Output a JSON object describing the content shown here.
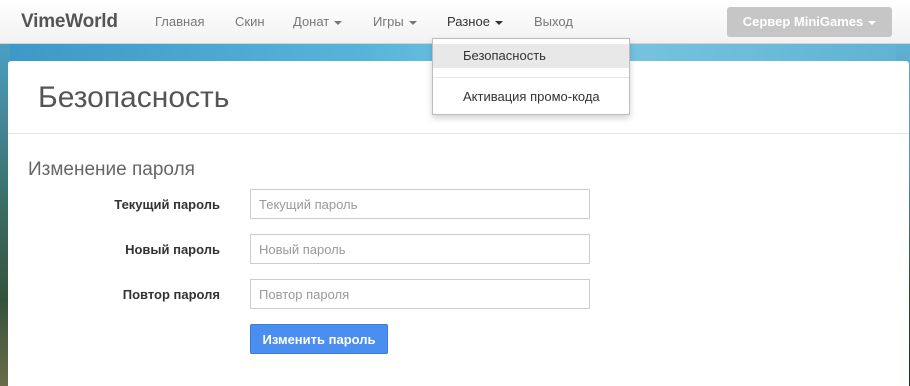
{
  "navbar": {
    "brand": "VimeWorld",
    "items": [
      {
        "label": "Главная"
      },
      {
        "label": "Скин"
      },
      {
        "label": "Донат"
      },
      {
        "label": "Игры"
      },
      {
        "label": "Разное"
      },
      {
        "label": "Выход"
      }
    ],
    "server_button": "Сервер MiniGames"
  },
  "dropdown": {
    "items": [
      {
        "label": "Безопасность"
      },
      {
        "label": "Активация промо-кода"
      }
    ]
  },
  "page": {
    "title": "Безопасность",
    "section_title": "Изменение пароля"
  },
  "form": {
    "current_password": {
      "label": "Текущий пароль",
      "placeholder": "Текущий пароль"
    },
    "new_password": {
      "label": "Новый пароль",
      "placeholder": "Новый пароль"
    },
    "repeat_password": {
      "label": "Повтор пароля",
      "placeholder": "Повтор пароля"
    },
    "submit_label": "Изменить пароль"
  },
  "colors": {
    "accent": "#4a8ef0",
    "server_button": "#c6c6c6",
    "highlight": "#e8e8e8"
  }
}
